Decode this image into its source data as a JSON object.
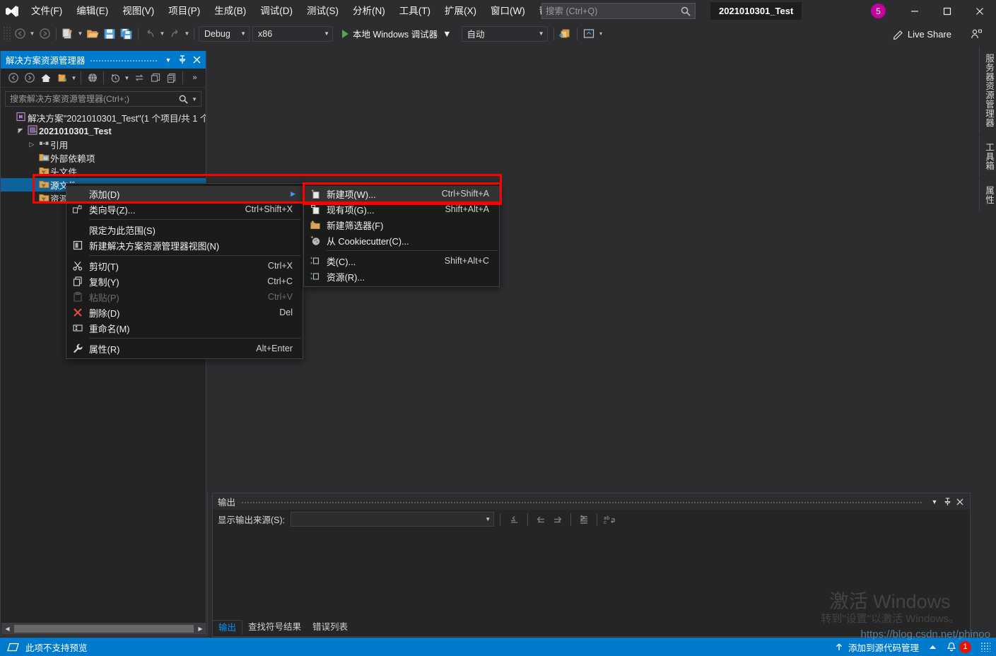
{
  "app": {
    "document_tab": "2021010301_Test",
    "notification_count": "5",
    "live_share": "Live Share"
  },
  "menu": {
    "items": [
      {
        "label": "文件(F)",
        "name": "menu-file"
      },
      {
        "label": "编辑(E)",
        "name": "menu-edit"
      },
      {
        "label": "视图(V)",
        "name": "menu-view"
      },
      {
        "label": "项目(P)",
        "name": "menu-project"
      },
      {
        "label": "生成(B)",
        "name": "menu-build"
      },
      {
        "label": "调试(D)",
        "name": "menu-debug"
      },
      {
        "label": "测试(S)",
        "name": "menu-test"
      },
      {
        "label": "分析(N)",
        "name": "menu-analyze"
      },
      {
        "label": "工具(T)",
        "name": "menu-tools"
      },
      {
        "label": "扩展(X)",
        "name": "menu-extensions"
      },
      {
        "label": "窗口(W)",
        "name": "menu-window"
      },
      {
        "label": "帮助(H)",
        "name": "menu-help"
      }
    ]
  },
  "search": {
    "placeholder": "搜索 (Ctrl+Q)",
    "value": ""
  },
  "toolbar": {
    "config": "Debug",
    "platform": "x86",
    "run_target": "本地 Windows 调试器",
    "auto": "自动"
  },
  "solution_explorer": {
    "title": "解决方案资源管理器",
    "search_placeholder": "搜索解决方案资源管理器(Ctrl+;)",
    "tree": [
      {
        "label": "解决方案\"2021010301_Test\"(1 个项目/共 1 个",
        "indent": 0,
        "icon": "solution-icon",
        "expander": "none",
        "selected": false,
        "bold": false
      },
      {
        "label": "2021010301_Test",
        "indent": 1,
        "icon": "project-icon",
        "expander": "open",
        "selected": false,
        "bold": true
      },
      {
        "label": "引用",
        "indent": 2,
        "icon": "references-icon",
        "expander": "closed",
        "selected": false,
        "bold": false
      },
      {
        "label": "外部依赖项",
        "indent": 2,
        "icon": "folder-ext-icon",
        "expander": "none",
        "selected": false,
        "bold": false
      },
      {
        "label": "头文件",
        "indent": 2,
        "icon": "filter-folder-icon",
        "expander": "none",
        "selected": false,
        "bold": false
      },
      {
        "label": "源文件",
        "indent": 2,
        "icon": "filter-folder-icon",
        "expander": "none",
        "selected": true,
        "bold": false
      },
      {
        "label": "资源文件",
        "indent": 2,
        "icon": "filter-folder-icon",
        "expander": "none",
        "selected": false,
        "bold": false
      }
    ]
  },
  "context_menu": {
    "items": [
      {
        "label": "添加(D)",
        "key": "",
        "icon": "",
        "submenu": true,
        "disabled": false,
        "highlight": true,
        "sep_after": false
      },
      {
        "label": "类向导(Z)...",
        "key": "Ctrl+Shift+X",
        "icon": "class-wizard-icon",
        "submenu": false,
        "disabled": false,
        "highlight": false,
        "sep_after": true
      },
      {
        "label": "限定为此范围(S)",
        "key": "",
        "icon": "",
        "submenu": false,
        "disabled": false,
        "highlight": false,
        "sep_after": false
      },
      {
        "label": "新建解决方案资源管理器视图(N)",
        "key": "",
        "icon": "new-view-icon",
        "submenu": false,
        "disabled": false,
        "highlight": false,
        "sep_after": true
      },
      {
        "label": "剪切(T)",
        "key": "Ctrl+X",
        "icon": "scissors-icon",
        "submenu": false,
        "disabled": false,
        "highlight": false,
        "sep_after": false
      },
      {
        "label": "复制(Y)",
        "key": "Ctrl+C",
        "icon": "copy-icon",
        "submenu": false,
        "disabled": false,
        "highlight": false,
        "sep_after": false
      },
      {
        "label": "粘贴(P)",
        "key": "Ctrl+V",
        "icon": "paste-icon",
        "submenu": false,
        "disabled": true,
        "highlight": false,
        "sep_after": false
      },
      {
        "label": "删除(D)",
        "key": "Del",
        "icon": "delete-x-icon",
        "submenu": false,
        "disabled": false,
        "highlight": false,
        "sep_after": false
      },
      {
        "label": "重命名(M)",
        "key": "",
        "icon": "rename-icon",
        "submenu": false,
        "disabled": false,
        "highlight": false,
        "sep_after": true
      },
      {
        "label": "属性(R)",
        "key": "Alt+Enter",
        "icon": "wrench-icon",
        "submenu": false,
        "disabled": false,
        "highlight": false,
        "sep_after": false
      }
    ]
  },
  "submenu": {
    "items": [
      {
        "label": "新建项(W)...",
        "key": "Ctrl+Shift+A",
        "icon": "new-item-icon",
        "highlight": true,
        "sep_after": false
      },
      {
        "label": "现有项(G)...",
        "key": "Shift+Alt+A",
        "icon": "existing-item-icon",
        "highlight": false,
        "sep_after": false
      },
      {
        "label": "新建筛选器(F)",
        "key": "",
        "icon": "new-filter-icon",
        "highlight": false,
        "sep_after": false
      },
      {
        "label": "从 Cookiecutter(C)...",
        "key": "",
        "icon": "cookiecutter-icon",
        "highlight": false,
        "sep_after": true
      },
      {
        "label": "类(C)...",
        "key": "Shift+Alt+C",
        "icon": "class-icon",
        "highlight": false,
        "sep_after": false
      },
      {
        "label": "资源(R)...",
        "key": "",
        "icon": "resource-icon",
        "highlight": false,
        "sep_after": false
      }
    ]
  },
  "output": {
    "title": "输出",
    "source_label": "显示输出来源(S):",
    "source_value": ""
  },
  "bottom_tabs": [
    {
      "label": "输出",
      "active": true
    },
    {
      "label": "查找符号结果",
      "active": false
    },
    {
      "label": "错误列表",
      "active": false
    }
  ],
  "right_tabs": [
    {
      "label": "服务器资源管理器"
    },
    {
      "label": "工具箱"
    },
    {
      "label": "属性"
    }
  ],
  "statusbar": {
    "message": "此项不支持预览",
    "source_control": "添加到源代码管理",
    "notif_count": "1"
  },
  "watermark": {
    "line1": "激活 Windows",
    "line2": "转到\"设置\"以激活 Windows。",
    "url": "https://blog.csdn.net/phinoo"
  },
  "colors": {
    "accent": "#007acc",
    "selection": "#0e639c",
    "annotation": "#fe0000",
    "chrome": "#2d2d30",
    "panel": "#252526",
    "menu": "#1b1b1c"
  }
}
